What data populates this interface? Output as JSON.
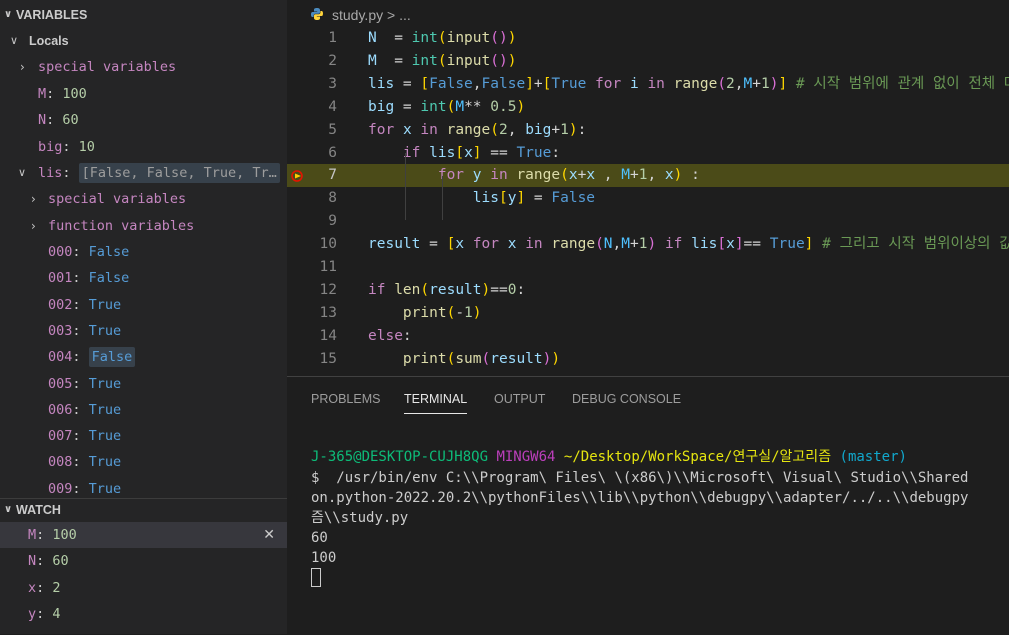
{
  "sidebar": {
    "variables_title": "VARIABLES",
    "locals_label": "Locals",
    "special_variables": "special variables",
    "function_variables": "function variables",
    "locals": [
      {
        "key": "M",
        "value": "100"
      },
      {
        "key": "N",
        "value": "60"
      },
      {
        "key": "big",
        "value": "10"
      }
    ],
    "lis": {
      "key": "lis",
      "value": "[False, False, True, Tr…"
    },
    "lis_items": [
      {
        "key": "000",
        "value": "False"
      },
      {
        "key": "001",
        "value": "False"
      },
      {
        "key": "002",
        "value": "True"
      },
      {
        "key": "003",
        "value": "True"
      },
      {
        "key": "004",
        "value": "False"
      },
      {
        "key": "005",
        "value": "True"
      },
      {
        "key": "006",
        "value": "True"
      },
      {
        "key": "007",
        "value": "True"
      },
      {
        "key": "008",
        "value": "True"
      },
      {
        "key": "009",
        "value": "True"
      }
    ],
    "watch_title": "WATCH",
    "watch": [
      {
        "key": "M",
        "value": "100"
      },
      {
        "key": "N",
        "value": "60"
      },
      {
        "key": "x",
        "value": "2"
      },
      {
        "key": "y",
        "value": "4"
      }
    ]
  },
  "editor": {
    "breadcrumb_file": "study.py",
    "breadcrumb_rest": "> ...",
    "current_line": 7,
    "lines": [
      {
        "n": "1",
        "tokens": [
          [
            "t-var",
            "N"
          ],
          [
            "",
            "  = "
          ],
          [
            "t-cls",
            "int"
          ],
          [
            "t-p1",
            "("
          ],
          [
            "t-fn",
            "input"
          ],
          [
            "t-p2",
            "()"
          ],
          [
            "t-p1",
            ")"
          ]
        ]
      },
      {
        "n": "2",
        "tokens": [
          [
            "t-var",
            "M"
          ],
          [
            "",
            "  = "
          ],
          [
            "t-cls",
            "int"
          ],
          [
            "t-p1",
            "("
          ],
          [
            "t-fn",
            "input"
          ],
          [
            "t-p2",
            "()"
          ],
          [
            "t-p1",
            ")"
          ]
        ]
      },
      {
        "n": "3",
        "tokens": [
          [
            "t-var",
            "lis"
          ],
          [
            "",
            " = "
          ],
          [
            "t-p1",
            "["
          ],
          [
            "t-bk",
            "False"
          ],
          [
            "",
            ","
          ],
          [
            "t-bk",
            "False"
          ],
          [
            "t-p1",
            "]"
          ],
          [
            "",
            "+"
          ],
          [
            "t-p1",
            "["
          ],
          [
            "t-bk",
            "True"
          ],
          [
            "",
            " "
          ],
          [
            "t-kw",
            "for"
          ],
          [
            "",
            " "
          ],
          [
            "t-var",
            "i"
          ],
          [
            "",
            " "
          ],
          [
            "t-kw",
            "in"
          ],
          [
            "",
            " "
          ],
          [
            "t-fn",
            "range"
          ],
          [
            "t-p2",
            "("
          ],
          [
            "t-num",
            "2"
          ],
          [
            "",
            ","
          ],
          [
            "t-const",
            "M"
          ],
          [
            "",
            "+"
          ],
          [
            "t-num",
            "1"
          ],
          [
            "t-p2",
            ")"
          ],
          [
            "t-p1",
            "]"
          ],
          [
            "",
            " "
          ],
          [
            "t-cm",
            "# 시작 범위에 관계 없이 전체 다 계산"
          ]
        ]
      },
      {
        "n": "4",
        "tokens": [
          [
            "t-var",
            "big"
          ],
          [
            "",
            " = "
          ],
          [
            "t-cls",
            "int"
          ],
          [
            "t-p1",
            "("
          ],
          [
            "t-const",
            "M"
          ],
          [
            "",
            "** "
          ],
          [
            "t-num",
            "0.5"
          ],
          [
            "t-p1",
            ")"
          ]
        ]
      },
      {
        "n": "5",
        "tokens": [
          [
            "t-kw",
            "for"
          ],
          [
            "",
            " "
          ],
          [
            "t-var",
            "x"
          ],
          [
            "",
            " "
          ],
          [
            "t-kw",
            "in"
          ],
          [
            "",
            " "
          ],
          [
            "t-fn",
            "range"
          ],
          [
            "t-p1",
            "("
          ],
          [
            "t-num",
            "2"
          ],
          [
            "",
            ", "
          ],
          [
            "t-var",
            "big"
          ],
          [
            "",
            "+"
          ],
          [
            "t-num",
            "1"
          ],
          [
            "t-p1",
            ")"
          ],
          [
            "",
            ":"
          ]
        ]
      },
      {
        "n": "6",
        "tokens": [
          [
            "",
            "    "
          ],
          [
            "t-kw",
            "if"
          ],
          [
            "",
            " "
          ],
          [
            "t-var",
            "lis"
          ],
          [
            "t-p1",
            "["
          ],
          [
            "t-var",
            "x"
          ],
          [
            "t-p1",
            "]"
          ],
          [
            "",
            " == "
          ],
          [
            "t-bk",
            "True"
          ],
          [
            "",
            ":"
          ]
        ]
      },
      {
        "n": "7",
        "tokens": [
          [
            "",
            "        "
          ],
          [
            "t-kw",
            "for"
          ],
          [
            "",
            " "
          ],
          [
            "t-var",
            "y"
          ],
          [
            "",
            " "
          ],
          [
            "t-kw",
            "in"
          ],
          [
            "",
            " "
          ],
          [
            "t-fn",
            "range"
          ],
          [
            "t-p1",
            "("
          ],
          [
            "t-var",
            "x"
          ],
          [
            "",
            "+"
          ],
          [
            "t-var",
            "x"
          ],
          [
            "",
            " , "
          ],
          [
            "t-const",
            "M"
          ],
          [
            "",
            "+"
          ],
          [
            "t-num",
            "1"
          ],
          [
            "",
            ", "
          ],
          [
            "t-var",
            "x"
          ],
          [
            "t-p1",
            ")"
          ],
          [
            "",
            " :"
          ]
        ]
      },
      {
        "n": "8",
        "tokens": [
          [
            "",
            "            "
          ],
          [
            "t-var",
            "lis"
          ],
          [
            "t-p1",
            "["
          ],
          [
            "t-var",
            "y"
          ],
          [
            "t-p1",
            "]"
          ],
          [
            "",
            " = "
          ],
          [
            "t-bk",
            "False"
          ]
        ]
      },
      {
        "n": "9",
        "tokens": []
      },
      {
        "n": "10",
        "tokens": [
          [
            "t-var",
            "result"
          ],
          [
            "",
            " = "
          ],
          [
            "t-p1",
            "["
          ],
          [
            "t-var",
            "x"
          ],
          [
            "",
            " "
          ],
          [
            "t-kw",
            "for"
          ],
          [
            "",
            " "
          ],
          [
            "t-var",
            "x"
          ],
          [
            "",
            " "
          ],
          [
            "t-kw",
            "in"
          ],
          [
            "",
            " "
          ],
          [
            "t-fn",
            "range"
          ],
          [
            "t-p2",
            "("
          ],
          [
            "t-const",
            "N"
          ],
          [
            "",
            ","
          ],
          [
            "t-const",
            "M"
          ],
          [
            "",
            "+"
          ],
          [
            "t-num",
            "1"
          ],
          [
            "t-p2",
            ")"
          ],
          [
            "",
            " "
          ],
          [
            "t-kw",
            "if"
          ],
          [
            "",
            " "
          ],
          [
            "t-var",
            "lis"
          ],
          [
            "t-p2",
            "["
          ],
          [
            "t-var",
            "x"
          ],
          [
            "t-p2",
            "]"
          ],
          [
            "",
            "== "
          ],
          [
            "t-bk",
            "True"
          ],
          [
            "t-p1",
            "]"
          ],
          [
            "",
            " "
          ],
          [
            "t-cm",
            "# 그리고 시작 범위이상의 값만 추출"
          ]
        ]
      },
      {
        "n": "11",
        "tokens": []
      },
      {
        "n": "12",
        "tokens": [
          [
            "t-kw",
            "if"
          ],
          [
            "",
            " "
          ],
          [
            "t-fn",
            "len"
          ],
          [
            "t-p1",
            "("
          ],
          [
            "t-var",
            "result"
          ],
          [
            "t-p1",
            ")"
          ],
          [
            "",
            "=="
          ],
          [
            "t-num",
            "0"
          ],
          [
            "",
            ":"
          ]
        ]
      },
      {
        "n": "13",
        "tokens": [
          [
            "",
            "    "
          ],
          [
            "t-fn",
            "print"
          ],
          [
            "t-p1",
            "("
          ],
          [
            "",
            "-"
          ],
          [
            "t-num",
            "1"
          ],
          [
            "t-p1",
            ")"
          ]
        ]
      },
      {
        "n": "14",
        "tokens": [
          [
            "t-kw",
            "else"
          ],
          [
            "",
            ":"
          ]
        ]
      },
      {
        "n": "15",
        "tokens": [
          [
            "",
            "    "
          ],
          [
            "t-fn",
            "print"
          ],
          [
            "t-p1",
            "("
          ],
          [
            "t-fn",
            "sum"
          ],
          [
            "t-p2",
            "("
          ],
          [
            "t-var",
            "result"
          ],
          [
            "t-p2",
            ")"
          ],
          [
            "t-p1",
            ")"
          ]
        ]
      }
    ]
  },
  "panel": {
    "tabs": [
      {
        "label": "PROBLEMS",
        "active": false
      },
      {
        "label": "TERMINAL",
        "active": true
      },
      {
        "label": "OUTPUT",
        "active": false
      },
      {
        "label": "DEBUG CONSOLE",
        "active": false
      }
    ],
    "prompt_user": "J-365@DESKTOP-CUJH8QG",
    "prompt_env": "MINGW64",
    "prompt_path": "~/Desktop/WorkSpace/연구실/알고리즘",
    "prompt_branch": "(master)",
    "cmd_line1": "$  /usr/bin/env C:\\\\Program\\ Files\\ \\(x86\\)\\\\Microsoft\\ Visual\\ Studio\\\\Shared",
    "cmd_line2": "on.python-2022.20.2\\\\pythonFiles\\\\lib\\\\python\\\\debugpy\\\\adapter/../..\\\\debugpy",
    "cmd_line3": "즘\\\\study.py",
    "out1": "60",
    "out2": "100"
  }
}
